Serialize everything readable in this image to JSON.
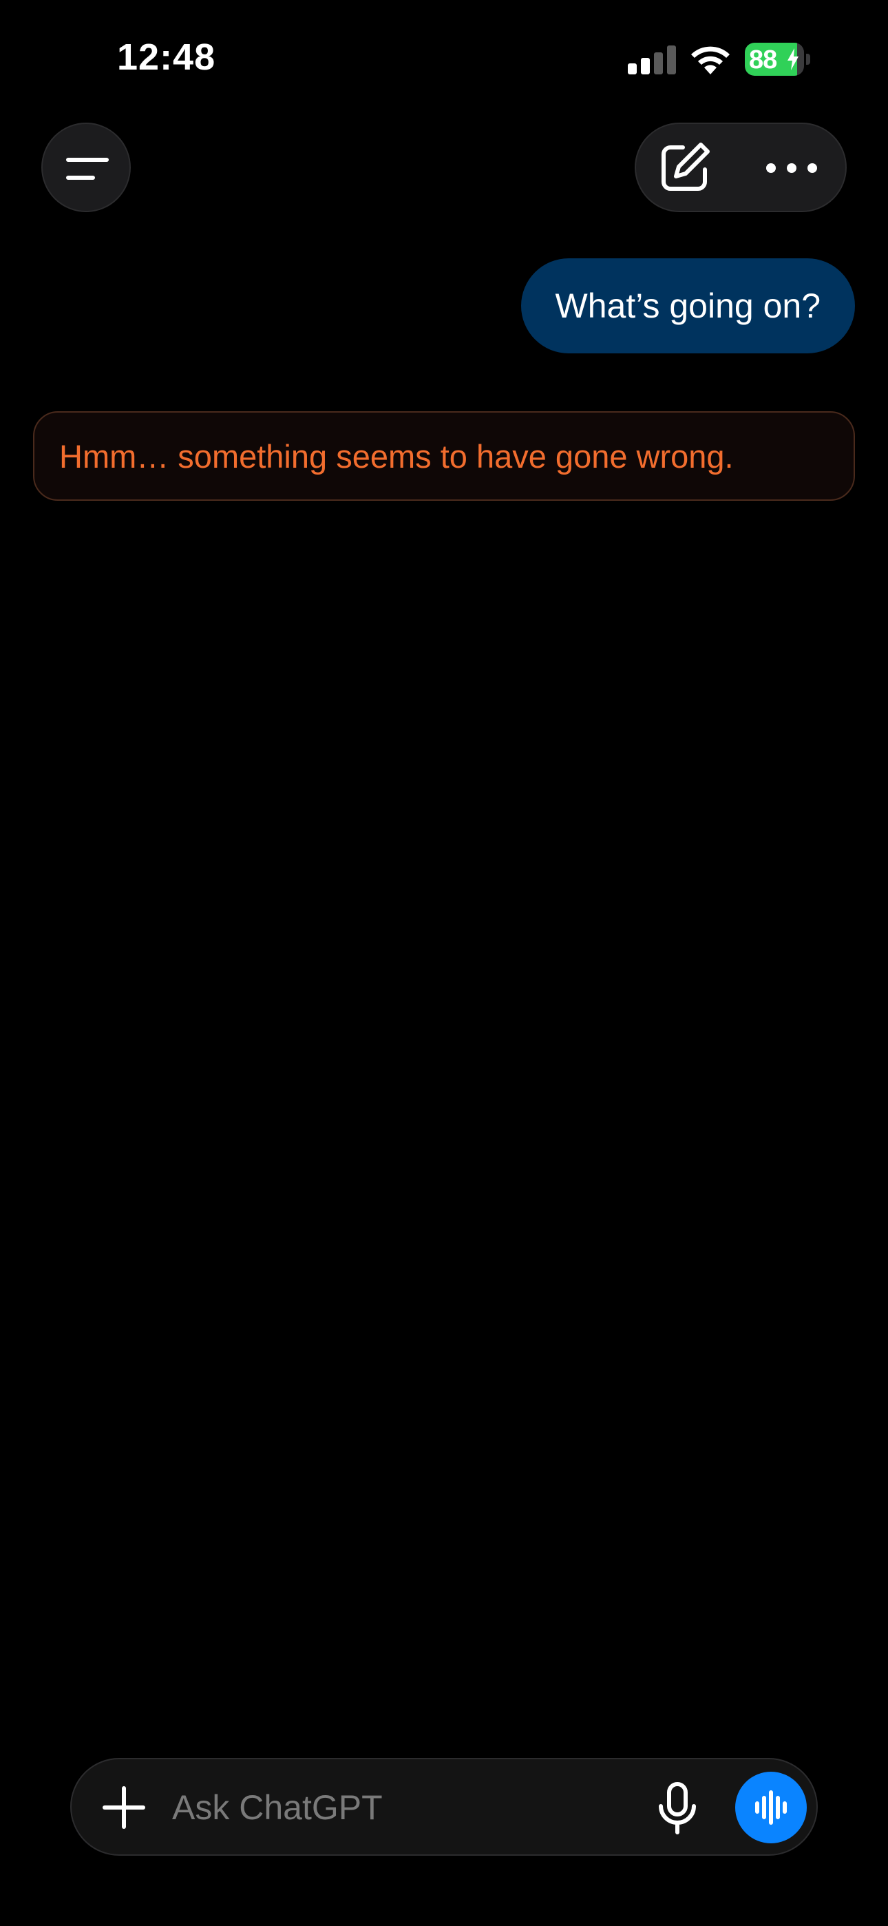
{
  "status_bar": {
    "time": "12:48",
    "battery_percent": "88",
    "battery_level": 0.88,
    "signal_bars_active": 2,
    "signal_bars_total": 4
  },
  "icons": {
    "menu": "menu-icon",
    "new_chat": "compose-icon",
    "more": "more-icon",
    "attach": "plus-icon",
    "mic": "microphone-icon",
    "voice": "voice-waveform-icon"
  },
  "conversation": {
    "user_message": "What’s going on?",
    "error_message": "Hmm… something seems to have gone wrong."
  },
  "composer": {
    "placeholder": "Ask ChatGPT",
    "value": ""
  },
  "colors": {
    "user_bubble": "#00335e",
    "error_text": "#f26d2e",
    "voice_button": "#0a84ff"
  }
}
